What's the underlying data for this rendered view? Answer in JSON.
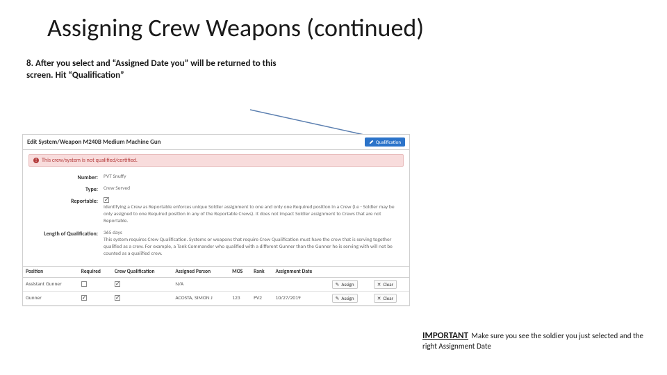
{
  "title": "Assigning Crew Weapons (continued)",
  "step8_text": "8. After you select and “Assigned Date you” will be returned to this screen. Hit “Qualification”",
  "panel": {
    "header_title": "Edit System/Weapon M240B Medium Machine Gun",
    "qual_button": "Qualification",
    "alert_text": "This crew/system is not qualified/certified.",
    "fields": {
      "number_label": "Number:",
      "number_value": "PVT Snuffy",
      "type_label": "Type:",
      "type_value": "Crew Served",
      "reportable_label": "Reportable:",
      "reportable_checked": true,
      "reportable_help": "Identifying a Crew as Reportable enforces unique Soldier assignment to one and only one Required position in a Crew (i.e - Soldier may be only assigned to one Required position in any of the Reportable Crews). It does not impact Soldier assignment to Crews that are not Reportable.",
      "loq_label": "Length of Qualification:",
      "loq_value": "365 days",
      "loq_help": "This system requires Crew Qualification. Systems or weapons that require Crew Qualification must have the crew that is serving together qualified as a crew. For example, a Tank Commander who qualified with a different Gunner than the Gunner he is serving with will not be counted as a qualified crew."
    },
    "columns": {
      "position": "Position",
      "required": "Required",
      "crew_qual": "Crew Qualification",
      "assigned_person": "Assigned Person",
      "mos": "MOS",
      "rank": "Rank",
      "assignment_date": "Assignment Date"
    },
    "rows": [
      {
        "position": "Assistant Gunner",
        "required": false,
        "crew_qual": true,
        "assigned_person": "N/A",
        "mos": "",
        "rank": "",
        "assignment_date": ""
      },
      {
        "position": "Gunner",
        "required": true,
        "crew_qual": true,
        "assigned_person": "ACOSTA, SIMON J",
        "mos": "123",
        "rank": "PV2",
        "assignment_date": "10/27/2019"
      }
    ],
    "assign_label": "Assign",
    "clear_label": "Clear"
  },
  "important": {
    "lead": "IMPORTANT",
    "body": "Make sure you see the soldier you just selected and the right Assignment Date"
  }
}
